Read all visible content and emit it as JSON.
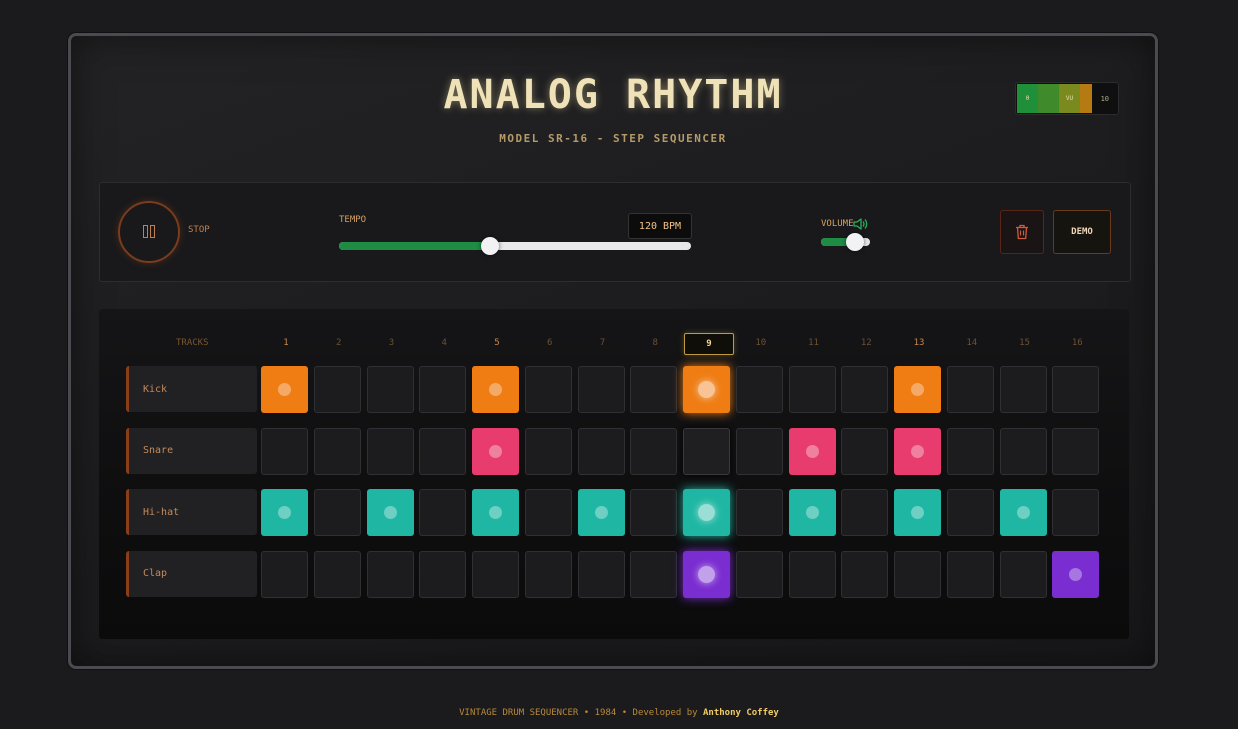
{
  "header": {
    "title": "ANALOG RHYTHM",
    "subtitle": "MODEL SR-16 - STEP SEQUENCER"
  },
  "vu_meter": {
    "min_label": "0",
    "mid_label": "VU",
    "max_label": "10",
    "segments": [
      "#1f8f3a",
      "#3f8a2a",
      "#7a8a1e",
      "#b57a12"
    ]
  },
  "controls": {
    "play_state_label": "STOP",
    "tempo_label": "TEMPO",
    "bpm_display": "120 BPM",
    "tempo_level": 0.43,
    "volume_label": "VOLUME",
    "volume_level": 0.7,
    "demo_label": "DEMO",
    "icons": {
      "play_toggle": "pause-icon",
      "clear": "trash-icon",
      "volume": "speaker-icon"
    }
  },
  "sequencer": {
    "tracks_header": "TRACKS",
    "steps": [
      "1",
      "2",
      "3",
      "4",
      "5",
      "6",
      "7",
      "8",
      "9",
      "10",
      "11",
      "12",
      "13",
      "14",
      "15",
      "16"
    ],
    "current_step": 9,
    "tracks": [
      {
        "name": "Kick",
        "color": "#ef7d14",
        "active": [
          1,
          5,
          9,
          13
        ]
      },
      {
        "name": "Snare",
        "color": "#e83c6e",
        "active": [
          5,
          11,
          13
        ]
      },
      {
        "name": "Hi-hat",
        "color": "#1fb7a3",
        "active": [
          1,
          3,
          5,
          7,
          9,
          11,
          13,
          15
        ]
      },
      {
        "name": "Clap",
        "color": "#7a2dd0",
        "active": [
          9,
          16
        ]
      }
    ]
  },
  "footer": {
    "text": "VINTAGE DRUM SEQUENCER • 1984 • Developed by",
    "author": "Anthony Coffey"
  },
  "colors": {
    "accent": "#d7a060",
    "slider_fill": "#1e8c45"
  }
}
